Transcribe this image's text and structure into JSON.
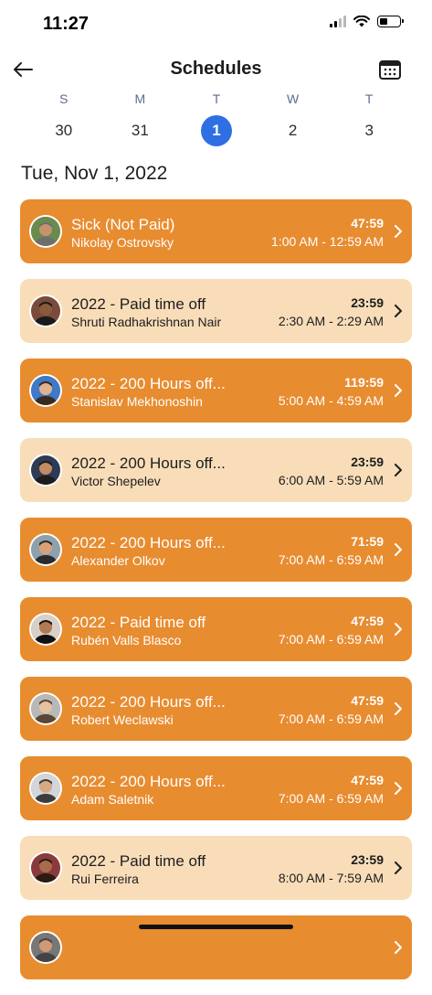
{
  "status_bar": {
    "time": "11:27"
  },
  "header": {
    "title": "Schedules",
    "back_icon": "arrow-left-icon",
    "calendar_icon": "calendar-icon"
  },
  "week": [
    {
      "dow": "S",
      "date": "30",
      "selected": false
    },
    {
      "dow": "M",
      "date": "31",
      "selected": false
    },
    {
      "dow": "T",
      "date": "1",
      "selected": true
    },
    {
      "dow": "W",
      "date": "2",
      "selected": false
    },
    {
      "dow": "T",
      "date": "3",
      "selected": false
    }
  ],
  "date_heading": "Tue, Nov 1, 2022",
  "colors": {
    "accent": "#2f6fe4",
    "card_dark": "#e88c30",
    "card_light": "#f8ddb8"
  },
  "schedules": [
    {
      "type": "Sick (Not Paid)",
      "name": "Nikolay Ostrovsky",
      "duration": "47:59",
      "range": "1:00 AM - 12:59 AM",
      "style": "dark"
    },
    {
      "type": "2022 - Paid time off",
      "name": "Shruti Radhakrishnan Nair",
      "duration": "23:59",
      "range": "2:30 AM - 2:29 AM",
      "style": "light"
    },
    {
      "type": "2022 - 200 Hours off...",
      "name": "Stanislav Mekhonoshin",
      "duration": "119:59",
      "range": "5:00 AM - 4:59 AM",
      "style": "dark"
    },
    {
      "type": "2022 - 200 Hours off...",
      "name": "Victor Shepelev",
      "duration": "23:59",
      "range": "6:00 AM - 5:59 AM",
      "style": "light"
    },
    {
      "type": "2022 - 200 Hours off...",
      "name": "Alexander Olkov",
      "duration": "71:59",
      "range": "7:00 AM - 6:59 AM",
      "style": "dark"
    },
    {
      "type": "2022 - Paid time off",
      "name": "Rubén Valls Blasco",
      "duration": "47:59",
      "range": "7:00 AM - 6:59 AM",
      "style": "dark"
    },
    {
      "type": "2022 - 200 Hours off...",
      "name": "Robert Weclawski",
      "duration": "47:59",
      "range": "7:00 AM - 6:59 AM",
      "style": "dark"
    },
    {
      "type": "2022 - 200 Hours off...",
      "name": "Adam Saletnik",
      "duration": "47:59",
      "range": "7:00 AM - 6:59 AM",
      "style": "dark"
    },
    {
      "type": "2022 - Paid time off",
      "name": "Rui Ferreira",
      "duration": "23:59",
      "range": "8:00 AM - 7:59 AM",
      "style": "light"
    },
    {
      "type": "",
      "name": "",
      "duration": "",
      "range": "",
      "style": "dark"
    }
  ]
}
